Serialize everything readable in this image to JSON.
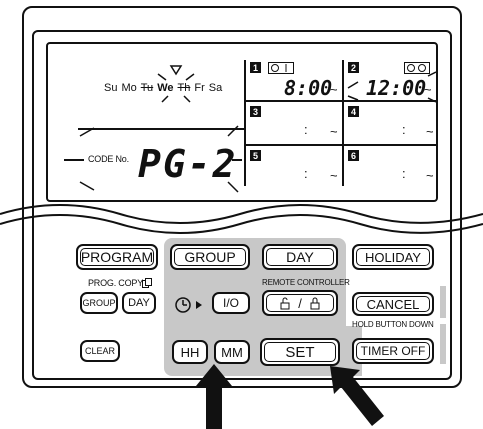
{
  "lcd": {
    "weekdays": [
      {
        "label": "Su",
        "active": false
      },
      {
        "label": "Mo",
        "active": false
      },
      {
        "label": "Tu",
        "active": false
      },
      {
        "label": "We",
        "active": true
      },
      {
        "label": "Th",
        "active": false
      },
      {
        "label": "Fr",
        "active": false
      },
      {
        "label": "Sa",
        "active": false
      }
    ],
    "code_label": "CODE No.",
    "code_value": "PG-2",
    "slots": [
      {
        "number": "1",
        "time": "8:00",
        "tilde": "~",
        "mode_icon": "on-timer-icon"
      },
      {
        "number": "2",
        "time": "12:00",
        "tilde": "~",
        "mode_icon": "off-timer-icon"
      },
      {
        "number": "3",
        "colon": ":",
        "tilde": "~"
      },
      {
        "number": "4",
        "colon": ":",
        "tilde": "~"
      },
      {
        "number": "5",
        "colon": ":",
        "tilde": "~"
      },
      {
        "number": "6",
        "colon": ":",
        "tilde": "~"
      }
    ]
  },
  "buttons": {
    "program": "PROGRAM",
    "group": "GROUP",
    "day": "DAY",
    "holiday": "HOLIDAY",
    "prog_copy_label": "PROG. COPY",
    "copy_group": "GROUP",
    "copy_day": "DAY",
    "timer_onoff": "I/O",
    "lock_separator": "/",
    "remote_controller_label": "REMOTE CONTROLLER",
    "cancel": "CANCEL",
    "hold_label": "HOLD BUTTON DOWN",
    "clear": "CLEAR",
    "hh": "HH",
    "mm": "MM",
    "set": "SET",
    "timer_off": "TIMER OFF"
  }
}
